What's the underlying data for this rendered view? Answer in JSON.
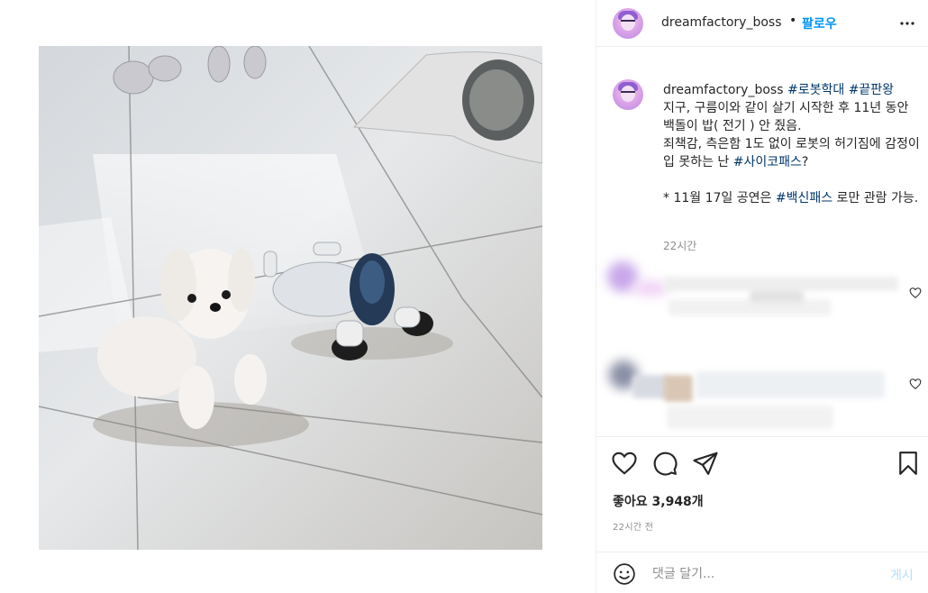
{
  "post": {
    "username": "dreamfactory_boss",
    "follow_label": "팔로우",
    "caption_hashtag_1": "#로봇학대",
    "caption_hashtag_2": "#끝판왕",
    "caption_text_1": "지구, 구름이와 같이 살기 시작한 후 11년 동안 백돌이 밥( 전기 ) 안 줬음.\n죄책감, 측은함 1도 없이 로봇의 허기짐에 감정이입 못하는 난 ",
    "caption_hashtag_3": "#사이코패스",
    "caption_text_2": "?\n\n* 11월 17일 공연은 ",
    "caption_hashtag_4": "#백신패스",
    "caption_text_3": " 로만 관람 가능.",
    "caption_time": "22시간",
    "likes_text": "좋아요 3,948개",
    "post_time": "22시간 전"
  },
  "comment_box": {
    "placeholder": "댓글 달기...",
    "post_label": "게시"
  },
  "icons": {
    "more": "more-horizontal-icon",
    "like": "heart-icon",
    "comment": "comment-bubble-icon",
    "share": "paper-plane-icon",
    "save": "bookmark-icon",
    "emoji": "emoji-smile-icon"
  },
  "colors": {
    "accent": "#0095f6",
    "hashtag": "#00376b",
    "muted": "#8e8e8e",
    "post_button_disabled": "#b2dffc"
  }
}
